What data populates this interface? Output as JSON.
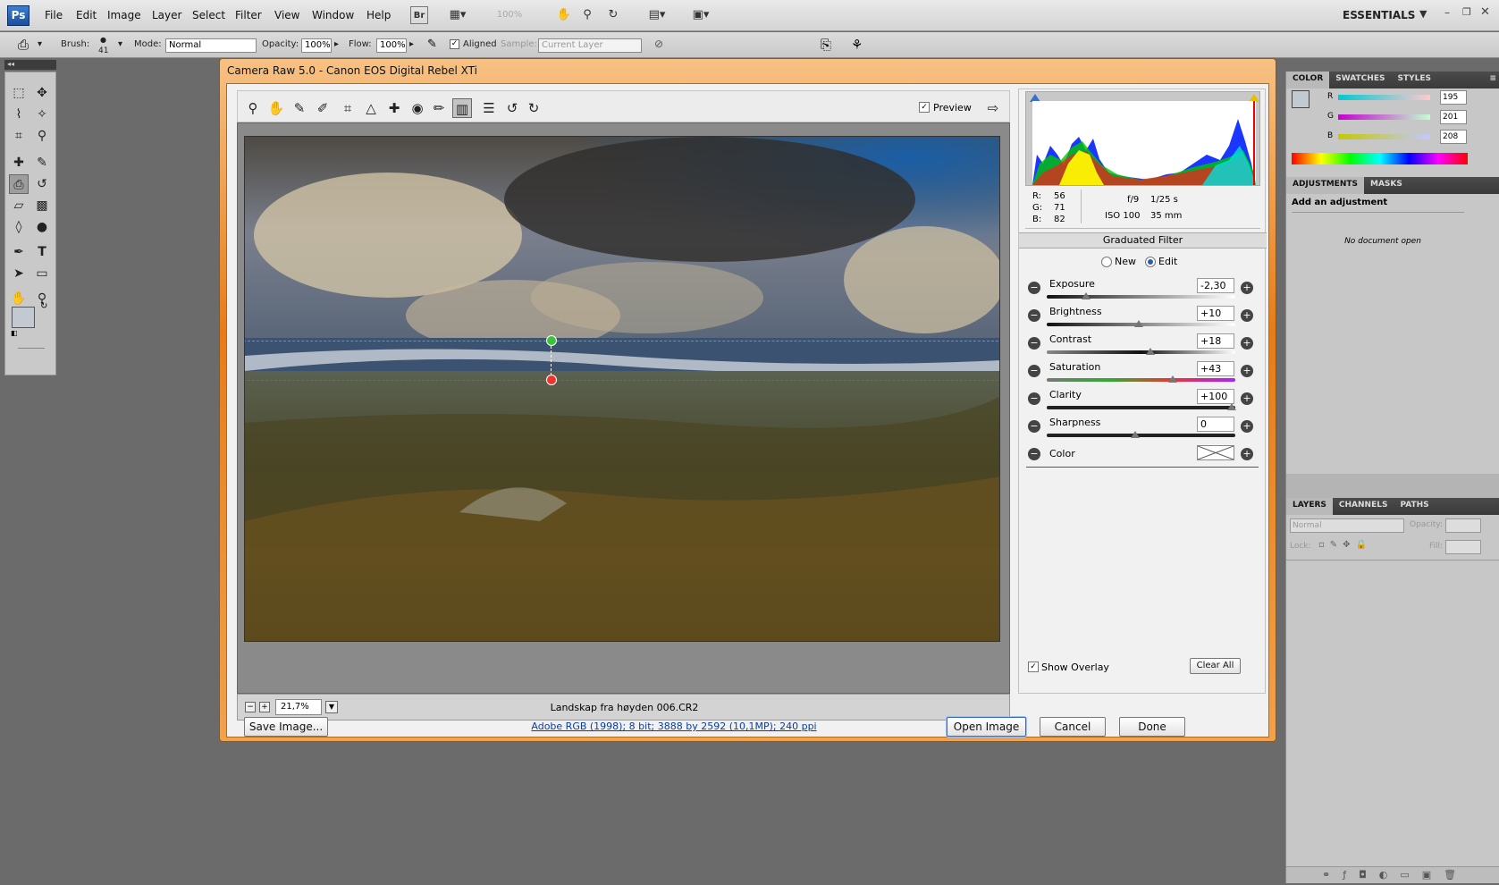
{
  "app": {
    "logo": "Ps",
    "workspace": "ESSENTIALS"
  },
  "menu": [
    "File",
    "Edit",
    "Image",
    "Layer",
    "Select",
    "Filter",
    "View",
    "Window",
    "Help"
  ],
  "menu_extra": {
    "bridge": "Br",
    "zoom": "100%"
  },
  "options": {
    "brush_label": "Brush:",
    "brush_size": "41",
    "mode_label": "Mode:",
    "mode_value": "Normal",
    "opacity_label": "Opacity:",
    "opacity_value": "100%",
    "flow_label": "Flow:",
    "flow_value": "100%",
    "aligned_label": "Aligned",
    "sample_label": "Sample:",
    "sample_value": "Current Layer"
  },
  "camera_raw": {
    "title": "Camera Raw 5.0  -  Canon EOS Digital Rebel XTi",
    "preview_label": "Preview",
    "zoom_value": "21,7%",
    "filename": "Landskap fra høyden 006.CR2",
    "rgb": {
      "r_label": "R:",
      "r": "56",
      "g_label": "G:",
      "g": "71",
      "b_label": "B:",
      "b": "82"
    },
    "exif": {
      "aperture": "f/9",
      "shutter": "1/25 s",
      "iso": "ISO 100",
      "focal": "35 mm"
    },
    "panel_title": "Graduated Filter",
    "mode_new": "New",
    "mode_edit": "Edit",
    "sliders": [
      {
        "label": "Exposure",
        "value": "-2,30",
        "level": 0.21
      },
      {
        "label": "Brightness",
        "value": "+10",
        "level": 0.49
      },
      {
        "label": "Contrast",
        "value": "+18",
        "level": 0.55
      },
      {
        "label": "Saturation",
        "value": "+43",
        "level": 0.67
      },
      {
        "label": "Clarity",
        "value": "+100",
        "level": 0.98
      },
      {
        "label": "Sharpness",
        "value": "0",
        "level": 0.47
      }
    ],
    "color_label": "Color",
    "show_overlay_label": "Show Overlay",
    "clear_all_label": "Clear All",
    "save_image_label": "Save Image...",
    "workflow_link": "Adobe RGB (1998); 8 bit; 3888 by 2592 (10,1MP); 240 ppi",
    "open_image_label": "Open Image",
    "cancel_label": "Cancel",
    "done_label": "Done"
  },
  "color_panel": {
    "tabs": [
      "COLOR",
      "SWATCHES",
      "STYLES"
    ],
    "r_label": "R",
    "r": "195",
    "g_label": "G",
    "g": "201",
    "b_label": "B",
    "b": "208"
  },
  "adjustments_panel": {
    "tabs": [
      "ADJUSTMENTS",
      "MASKS"
    ],
    "heading": "Add an adjustment",
    "empty": "No document open"
  },
  "layers_panel": {
    "tabs": [
      "LAYERS",
      "CHANNELS",
      "PATHS"
    ],
    "blend": "Normal",
    "opacity_label": "Opacity:",
    "lock_label": "Lock:",
    "fill_label": "Fill:"
  },
  "colors": {
    "titlebar": "#e77c17",
    "accent": "#0a3d9e"
  }
}
